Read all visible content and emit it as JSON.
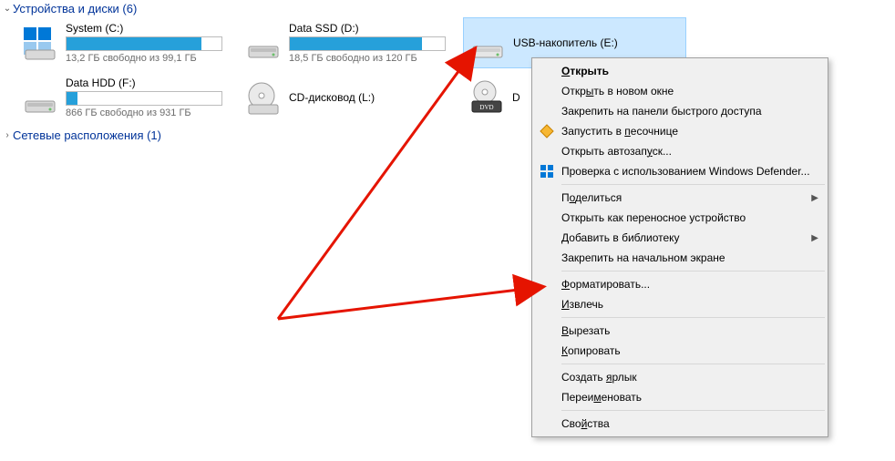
{
  "sections": {
    "devices": {
      "label": "Устройства и диски (6)"
    },
    "network": {
      "label": "Сетевые расположения (1)"
    }
  },
  "drives": {
    "c": {
      "name": "System (C:)",
      "sub": "13,2 ГБ свободно из 99,1 ГБ",
      "fill_pct": 87
    },
    "d": {
      "name": "Data SSD (D:)",
      "sub": "18,5 ГБ свободно из 120 ГБ",
      "fill_pct": 85
    },
    "e": {
      "name": "USB-накопитель (E:)",
      "sub": ""
    },
    "f": {
      "name": "Data HDD (F:)",
      "sub": "866 ГБ свободно из 931 ГБ",
      "fill_pct": 7
    },
    "l": {
      "name": "CD-дисковод (L:)",
      "sub": ""
    },
    "dvd2": {
      "name": "D",
      "sub": ""
    }
  },
  "ctx": {
    "open": "Открыть",
    "open_new_window": "Открыть в новом окне",
    "pin_quick": "Закрепить на панели быстрого доступа",
    "sandbox": "Запустить в песочнице",
    "autorun": "Открыть автозапуск...",
    "defender": "Проверка с использованием Windows Defender...",
    "share": "Поделиться",
    "portable": "Открыть как переносное устройство",
    "library": "Добавить в библиотеку",
    "pin_start": "Закрепить на начальном экране",
    "format": "Форматировать...",
    "eject": "Извлечь",
    "cut": "Вырезать",
    "copy": "Копировать",
    "shortcut": "Создать ярлык",
    "rename": "Переименовать",
    "properties": "Свойства"
  }
}
